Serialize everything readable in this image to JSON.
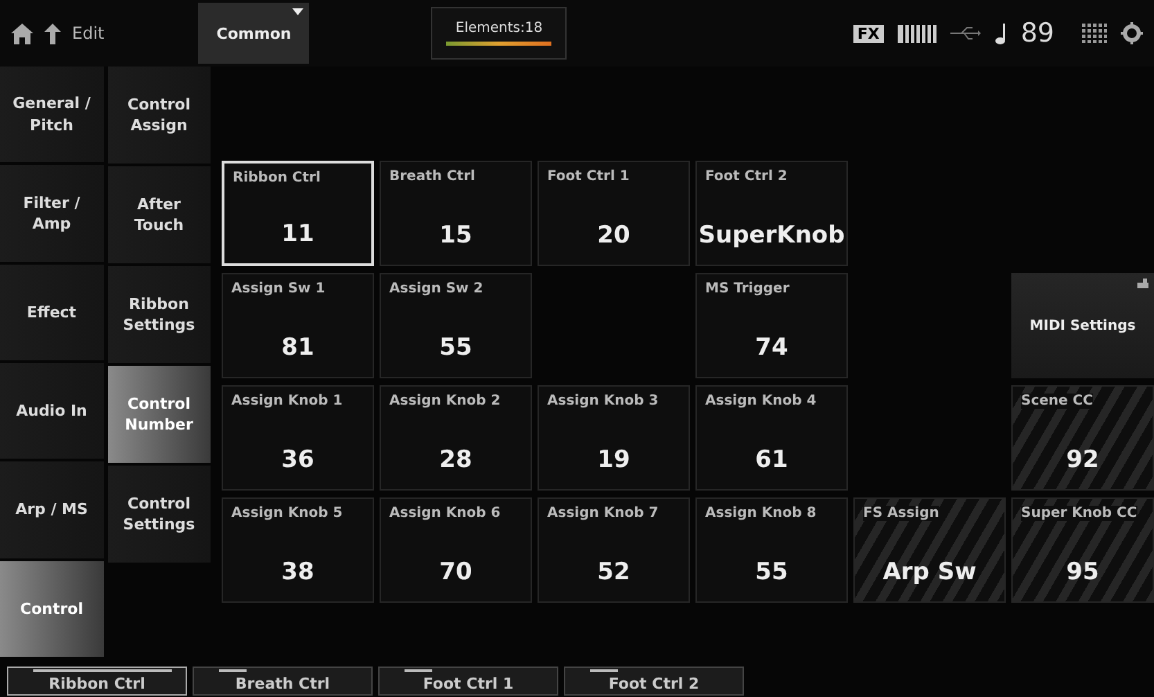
{
  "header": {
    "title": "Edit",
    "part_selector": "Common",
    "elements": {
      "label": "Elements:18",
      "level": 1
    },
    "fx_badge": "FX",
    "tempo": "89"
  },
  "categories": [
    {
      "label": "General / Pitch",
      "selected": false
    },
    {
      "label": "Filter / Amp",
      "selected": false
    },
    {
      "label": "Effect",
      "selected": false
    },
    {
      "label": "Audio In",
      "selected": false
    },
    {
      "label": "Arp / MS",
      "selected": false
    },
    {
      "label": "Control",
      "selected": true
    }
  ],
  "subcategories": [
    {
      "label": "Control Assign",
      "selected": false
    },
    {
      "label": "After Touch",
      "selected": false
    },
    {
      "label": "Ribbon Settings",
      "selected": false
    },
    {
      "label": "Control Number",
      "selected": true
    },
    {
      "label": "Control Settings",
      "selected": false
    }
  ],
  "grid": [
    [
      {
        "kind": "value",
        "label": "Ribbon Ctrl",
        "value": "11",
        "selected": true
      },
      {
        "kind": "value",
        "label": "Breath Ctrl",
        "value": "15",
        "selected": false
      },
      {
        "kind": "value",
        "label": "Foot Ctrl 1",
        "value": "20",
        "selected": false
      },
      {
        "kind": "value",
        "label": "Foot Ctrl 2",
        "value": "SuperKnob",
        "selected": false
      },
      {
        "kind": "empty"
      },
      {
        "kind": "empty"
      }
    ],
    [
      {
        "kind": "value",
        "label": "Assign Sw 1",
        "value": "81",
        "selected": false
      },
      {
        "kind": "value",
        "label": "Assign Sw 2",
        "value": "55",
        "selected": false
      },
      {
        "kind": "empty"
      },
      {
        "kind": "value",
        "label": "MS Trigger",
        "value": "74",
        "selected": false
      },
      {
        "kind": "empty"
      },
      {
        "kind": "button",
        "label": "MIDI Settings"
      }
    ],
    [
      {
        "kind": "value",
        "label": "Assign Knob 1",
        "value": "36",
        "selected": false
      },
      {
        "kind": "value",
        "label": "Assign Knob 2",
        "value": "28",
        "selected": false
      },
      {
        "kind": "value",
        "label": "Assign Knob 3",
        "value": "19",
        "selected": false
      },
      {
        "kind": "value",
        "label": "Assign Knob 4",
        "value": "61",
        "selected": false
      },
      {
        "kind": "empty"
      },
      {
        "kind": "hatched",
        "label": "Scene CC",
        "value": "92",
        "selected": false
      }
    ],
    [
      {
        "kind": "value",
        "label": "Assign Knob 5",
        "value": "38",
        "selected": false
      },
      {
        "kind": "value",
        "label": "Assign Knob 6",
        "value": "70",
        "selected": false
      },
      {
        "kind": "value",
        "label": "Assign Knob 7",
        "value": "52",
        "selected": false
      },
      {
        "kind": "value",
        "label": "Assign Knob 8",
        "value": "55",
        "selected": false
      },
      {
        "kind": "hatched",
        "label": "FS Assign",
        "value": "Arp Sw",
        "selected": false
      },
      {
        "kind": "hatched",
        "label": "Super Knob CC",
        "value": "95",
        "selected": false
      }
    ]
  ],
  "bottom_tabs": [
    {
      "label": "Ribbon Ctrl",
      "selected": true
    },
    {
      "label": "Breath Ctrl",
      "selected": false
    },
    {
      "label": "Foot Ctrl 1",
      "selected": false
    },
    {
      "label": "Foot Ctrl 2",
      "selected": false
    }
  ]
}
